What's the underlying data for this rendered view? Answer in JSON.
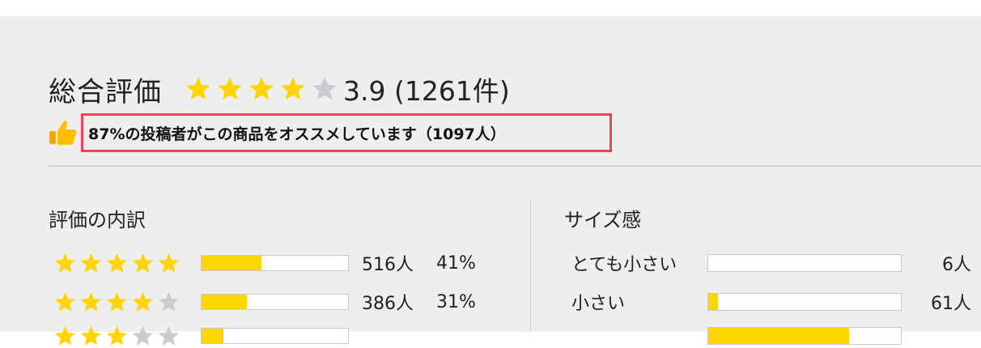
{
  "overall": {
    "title": "総合評価",
    "rating_stars": 3.9,
    "score_text": "3.9 (1261件)"
  },
  "recommend": {
    "icon": "thumbs-up-icon",
    "text": "87%の投稿者がこの商品をオススメしています（1097人）"
  },
  "breakdown": {
    "title": "評価の内訳",
    "rows": [
      {
        "stars": 5,
        "count": "516人",
        "percent": "41%",
        "fill": 0.41
      },
      {
        "stars": 4,
        "count": "386人",
        "percent": "31%",
        "fill": 0.31
      },
      {
        "stars": 3,
        "count": "",
        "percent": "",
        "fill": 0.15
      }
    ]
  },
  "size": {
    "title": "サイズ感",
    "rows": [
      {
        "label": "とても小さい",
        "count": "6人",
        "fill": 0.0
      },
      {
        "label": "小さい",
        "count": "61人",
        "fill": 0.05
      },
      {
        "label": "",
        "count": "",
        "fill": 0.73
      }
    ]
  },
  "colors": {
    "star_filled": "#ffd500",
    "star_empty": "#c6ccd2",
    "highlight_border": "#ee4455",
    "bar_fill": "#ffd500"
  }
}
